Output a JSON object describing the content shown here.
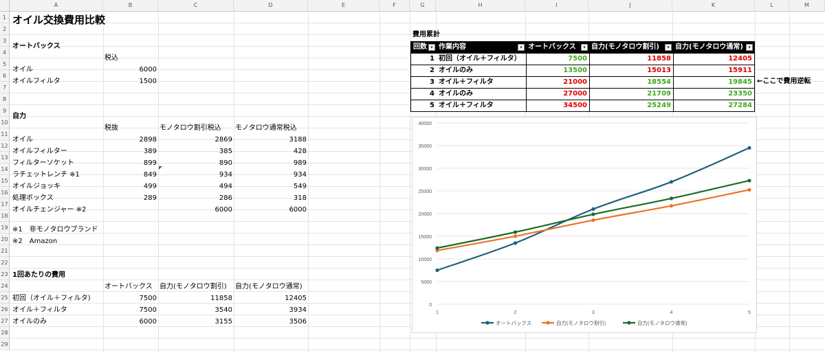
{
  "columns": [
    "A",
    "B",
    "C",
    "D",
    "E",
    "F",
    "G",
    "H",
    "I",
    "J",
    "K",
    "L",
    "M"
  ],
  "rows": [
    "1",
    "2",
    "3",
    "4",
    "5",
    "6",
    "7",
    "8",
    "9",
    "10",
    "11",
    "12",
    "13",
    "14",
    "15",
    "16",
    "17",
    "18",
    "19",
    "20",
    "21",
    "22",
    "23",
    "24",
    "25",
    "26",
    "27",
    "28",
    "29"
  ],
  "sheet": {
    "title": "オイル交換費用比較",
    "autobacs": {
      "heading": "オートバックス",
      "tax_label": "税込",
      "items": [
        {
          "name": "オイル",
          "value": "6000"
        },
        {
          "name": "オイルフィルタ",
          "value": "1500"
        }
      ]
    },
    "diy": {
      "heading": "自力",
      "col_pretax": "税抜",
      "col_mono_discount": "モノタロウ割引税込",
      "col_mono_regular": "モノタロウ通常税込",
      "items": [
        {
          "name": "オイル",
          "pretax": "2898",
          "discount": "2869",
          "regular": "3188"
        },
        {
          "name": "オイルフィルター",
          "pretax": "389",
          "discount": "385",
          "regular": "428"
        },
        {
          "name": "フィルターソケット",
          "pretax": "899",
          "discount": "890",
          "regular": "989"
        },
        {
          "name": "ラチェットレンチ ※1",
          "pretax": "849",
          "discount": "934",
          "regular": "934"
        },
        {
          "name": "オイルジョッキ",
          "pretax": "499",
          "discount": "494",
          "regular": "549"
        },
        {
          "name": "処理ボックス",
          "pretax": "289",
          "discount": "286",
          "regular": "318"
        },
        {
          "name": "オイルチェンジャー ※2",
          "pretax": "",
          "discount": "6000",
          "regular": "6000"
        }
      ]
    },
    "notes": [
      "※1　非モノタロウブランド",
      "※2　Amazon"
    ],
    "per_time": {
      "heading": "1回あたりの費用",
      "col1": "オートバックス",
      "col2": "自力(モノタロウ割引)",
      "col3": "自力(モノタロウ通常)",
      "rows": [
        {
          "name": "初回（オイル＋フィルタ)",
          "a": "7500",
          "b": "11858",
          "c": "12405"
        },
        {
          "name": "オイル＋フィルタ",
          "a": "7500",
          "b": "3540",
          "c": "3934"
        },
        {
          "name": "オイルのみ",
          "a": "6000",
          "b": "3155",
          "c": "3506"
        }
      ]
    }
  },
  "cumulative": {
    "label": "費用累計",
    "headers": [
      "回数",
      "作業内容",
      "オートバックス",
      "自力(モノタロウ割引)",
      "自力(モノタロウ通常)"
    ],
    "rows": [
      {
        "n": "1",
        "task": "初回（オイル＋フィルタ）",
        "a": "7500",
        "b": "11858",
        "c": "12405"
      },
      {
        "n": "2",
        "task": "オイルのみ",
        "a": "13500",
        "b": "15013",
        "c": "15911"
      },
      {
        "n": "3",
        "task": "オイル＋フィルタ",
        "a": "21000",
        "b": "18554",
        "c": "19845"
      },
      {
        "n": "4",
        "task": "オイルのみ",
        "a": "27000",
        "b": "21709",
        "c": "23350"
      },
      {
        "n": "5",
        "task": "オイル＋フィルタ",
        "a": "34500",
        "b": "25249",
        "c": "27284"
      }
    ],
    "note": "←ここで費用逆転",
    "colors": {
      "lower": "#3faa1e",
      "higher": "#e00000"
    }
  },
  "chart_data": {
    "type": "line",
    "x": [
      1,
      2,
      3,
      4,
      5
    ],
    "ylim": [
      0,
      40000
    ],
    "yticks": [
      "0",
      "5000",
      "10000",
      "15000",
      "20000",
      "25000",
      "30000",
      "35000",
      "40000"
    ],
    "xticks": [
      "1",
      "2",
      "3",
      "4",
      "5"
    ],
    "grid": true,
    "legend_position": "bottom",
    "series": [
      {
        "name": "オートバックス",
        "values": [
          7500,
          13500,
          21000,
          27000,
          34500
        ],
        "color": "#1f5f7f"
      },
      {
        "name": "自力(モノタロウ割引)",
        "values": [
          11858,
          15013,
          18554,
          21709,
          25249
        ],
        "color": "#e8742c"
      },
      {
        "name": "自力(モノタロウ通常)",
        "values": [
          12405,
          15911,
          19845,
          23350,
          27284
        ],
        "color": "#1e6b27"
      }
    ]
  }
}
